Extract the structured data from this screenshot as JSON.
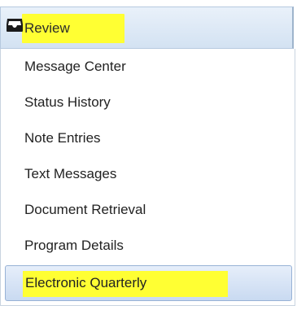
{
  "header": {
    "icon": "inbox-icon",
    "label": "Review",
    "highlight_color": "#ffff33"
  },
  "items": [
    {
      "label": "Message Center"
    },
    {
      "label": "Status History"
    },
    {
      "label": "Note Entries"
    },
    {
      "label": "Text Messages"
    },
    {
      "label": "Document Retrieval"
    },
    {
      "label": "Program Details"
    },
    {
      "label": "Electronic Quarterly",
      "selected": true
    }
  ],
  "colors": {
    "highlight": "#ffff33",
    "header_gradient_top": "#e9f1fa",
    "header_gradient_bottom": "#d3e2f2",
    "selected_gradient_top": "#e6eefa",
    "selected_gradient_bottom": "#c9daf1",
    "border": "#98b2d6"
  }
}
